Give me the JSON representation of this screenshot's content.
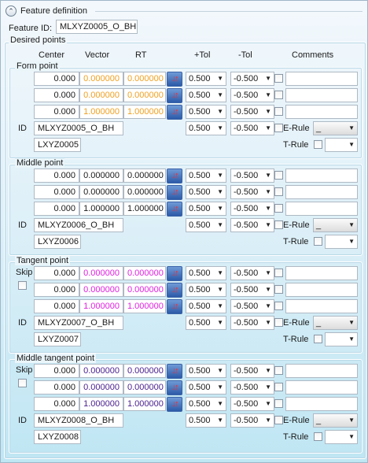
{
  "header": {
    "toggle_icon": "chevron-up-icon",
    "title": "Feature definition"
  },
  "feature": {
    "label": "Feature ID:",
    "value": "MLXYZ0005_O_BH"
  },
  "desired_points": {
    "label": "Desired points",
    "columns": {
      "center": "Center",
      "vector": "Vector",
      "rt": "RT",
      "plus_tol": "+Tol",
      "minus_tol": "-Tol",
      "comments": "Comments"
    }
  },
  "sections": [
    {
      "title": "Form point",
      "skip": "",
      "rows": [
        {
          "center": "0.000",
          "vector": "0.000000",
          "rt": "0.000000",
          "plus_tol": "0.500",
          "minus_tol": "-0.500",
          "comment": ""
        },
        {
          "center": "0.000",
          "vector": "0.000000",
          "rt": "0.000000",
          "plus_tol": "0.500",
          "minus_tol": "-0.500",
          "comment": ""
        },
        {
          "center": "0.000",
          "vector": "1.000000",
          "rt": "1.000000",
          "plus_tol": "0.500",
          "minus_tol": "-0.500",
          "comment": ""
        }
      ],
      "id_label": "ID",
      "id_value": "MLXYZ0005_O_BH",
      "id_plus_tol": "0.500",
      "id_minus_tol": "-0.500",
      "code": "LXYZ0005",
      "e_rule_label": "E-Rule",
      "e_rule_value": "_",
      "t_rule_label": "T-Rule",
      "t_rule_value": ""
    },
    {
      "title": "Middle point",
      "skip": "",
      "rows": [
        {
          "center": "0.000",
          "vector": "0.000000",
          "rt": "0.000000",
          "plus_tol": "0.500",
          "minus_tol": "-0.500",
          "comment": ""
        },
        {
          "center": "0.000",
          "vector": "0.000000",
          "rt": "0.000000",
          "plus_tol": "0.500",
          "minus_tol": "-0.500",
          "comment": ""
        },
        {
          "center": "0.000",
          "vector": "1.000000",
          "rt": "1.000000",
          "plus_tol": "0.500",
          "minus_tol": "-0.500",
          "comment": ""
        }
      ],
      "id_label": "ID",
      "id_value": "MLXYZ0006_O_BH",
      "id_plus_tol": "0.500",
      "id_minus_tol": "-0.500",
      "code": "LXYZ0006",
      "e_rule_label": "E-Rule",
      "e_rule_value": "_",
      "t_rule_label": "T-Rule",
      "t_rule_value": ""
    },
    {
      "title": "Tangent point",
      "skip": "Skip",
      "rows": [
        {
          "center": "0.000",
          "vector": "0.000000",
          "rt": "0.000000",
          "plus_tol": "0.500",
          "minus_tol": "-0.500",
          "comment": ""
        },
        {
          "center": "0.000",
          "vector": "0.000000",
          "rt": "0.000000",
          "plus_tol": "0.500",
          "minus_tol": "-0.500",
          "comment": ""
        },
        {
          "center": "0.000",
          "vector": "1.000000",
          "rt": "1.000000",
          "plus_tol": "0.500",
          "minus_tol": "-0.500",
          "comment": ""
        }
      ],
      "id_label": "ID",
      "id_value": "MLXYZ0007_O_BH",
      "id_plus_tol": "0.500",
      "id_minus_tol": "-0.500",
      "code": "LXYZ0007",
      "e_rule_label": "E-Rule",
      "e_rule_value": "_",
      "t_rule_label": "T-Rule",
      "t_rule_value": ""
    },
    {
      "title": "Middle tangent point",
      "skip": "Skip",
      "rows": [
        {
          "center": "0.000",
          "vector": "0.000000",
          "rt": "0.000000",
          "plus_tol": "0.500",
          "minus_tol": "-0.500",
          "comment": ""
        },
        {
          "center": "0.000",
          "vector": "0.000000",
          "rt": "0.000000",
          "plus_tol": "0.500",
          "minus_tol": "-0.500",
          "comment": ""
        },
        {
          "center": "0.000",
          "vector": "1.000000",
          "rt": "1.000000",
          "plus_tol": "0.500",
          "minus_tol": "-0.500",
          "comment": ""
        }
      ],
      "id_label": "ID",
      "id_value": "MLXYZ0008_O_BH",
      "id_plus_tol": "0.500",
      "id_minus_tol": "-0.500",
      "code": "LXYZ0008",
      "e_rule_label": "E-Rule",
      "e_rule_value": "_",
      "t_rule_label": "T-Rule",
      "t_rule_value": ""
    }
  ],
  "icons": {
    "flip": "flip-direction-icon",
    "dropdown": "chevron-down-icon"
  },
  "colors": {
    "vector_form": "#f0a020",
    "vector_tangent": "#e020e0",
    "vector_middle_tangent": "#4a2090",
    "flip_button": "#2d5aa8",
    "flip_arrow": "#ff2a2a"
  }
}
